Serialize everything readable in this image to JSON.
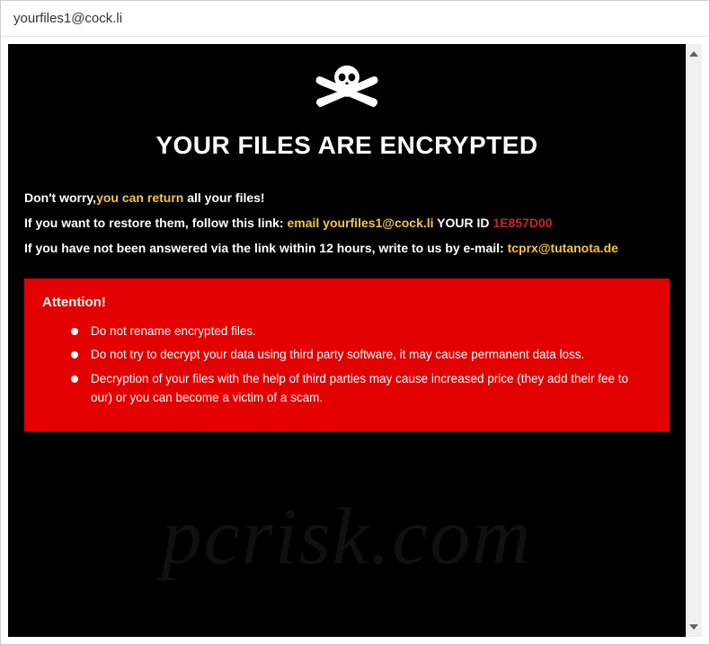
{
  "window": {
    "title": "yourfiles1@cock.li"
  },
  "content": {
    "heading": "YOUR FILES ARE ENCRYPTED",
    "line1": {
      "a": "Don't worry,",
      "b": "you can return",
      "c": " all your files!"
    },
    "line2": {
      "a": "If ",
      "b": "you want to restore them, follow this link:",
      "c": " email yourfiles1@cock.li",
      "d": "  YOUR ID ",
      "e": "1E857D00"
    },
    "line3": {
      "a": "If you have not been answered ",
      "b": "via the link ",
      "c": "within 12 hours",
      "d": ", write to us by e-mail: ",
      "e": "tcprx@tutanota.de"
    },
    "attention": {
      "title": "Attention!",
      "items": [
        "Do not rename encrypted files.",
        "Do not try to decrypt your data using third party software, it may cause permanent data loss.",
        "Decryption of your files with the help of third parties may cause increased price (they add their fee to our) or you can become a victim of a scam."
      ]
    }
  },
  "watermark": "pcrisk.com"
}
